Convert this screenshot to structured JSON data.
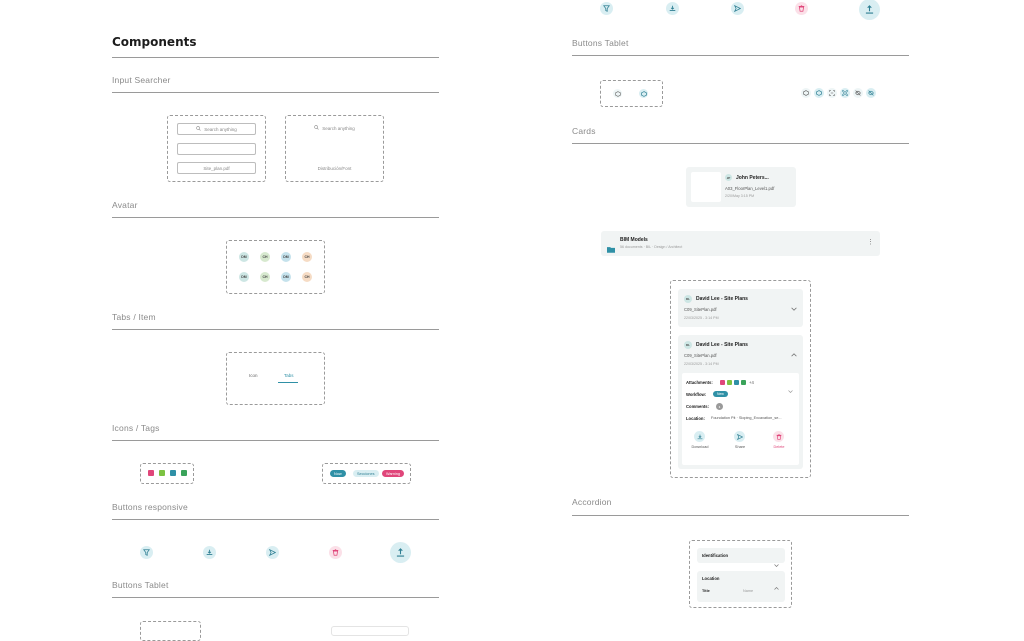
{
  "page": {
    "title": "Components"
  },
  "sections": {
    "input_searcher": "Input Searcher",
    "avatar": "Avatar",
    "tabs_item": "Tabs / Item",
    "icons_tags": "Icons / Tags",
    "buttons_responsive": "Buttons responsive",
    "buttons_tablet": "Buttons Tablet",
    "cards": "Cards",
    "accordion": "Accordion"
  },
  "input_searcher": {
    "search_placeholder": "Search anything",
    "file_value": "Site_plan.pdf",
    "search_placeholder_2": "Search anything",
    "dropdown_text": "Distribución/Font"
  },
  "avatar": {
    "row1": [
      "DM",
      "CH",
      "DM",
      "CH"
    ],
    "row2": [
      "DM",
      "CH",
      "DM",
      "CH"
    ]
  },
  "tabs": {
    "tab1": "Icon",
    "tab2": "Tabs"
  },
  "tags": {
    "pill1": "Now",
    "pill2": "Secciones",
    "pill3": "Warning"
  },
  "cards": {
    "small": {
      "initials": "JP",
      "name": "John Peters...",
      "file": "A03_FloorPlan_Level1.pdf",
      "date": "2/20/May 3:15 PM"
    },
    "folder": {
      "name": "BIM Models",
      "meta": "56 documents  ·  BIL  ·  Design / Architect"
    },
    "big1": {
      "initials": "DL",
      "name": "David Lee - Site Plans",
      "file": "C09_SitePlan.pdf",
      "date": "22/03/2025 - 3:14 PM"
    },
    "big2": {
      "initials": "DL",
      "name": "David Lee - Site Plans",
      "file": "C09_SitePlan.pdf",
      "date": "22/03/2025 - 3:14 PM",
      "attachments_label": "Attachments:",
      "attachments_more": "+4",
      "workflow_label": "Workflow:",
      "workflow_value": "New",
      "comments_label": "Comments:",
      "comments_count": "1",
      "location_label": "Location:",
      "location_value": "Foundation Pit · Sloping_Excavation_se...",
      "download": "Download",
      "share": "Share",
      "delete": "Delete"
    }
  },
  "accordion": {
    "item1": "Identification",
    "item2": "Location",
    "row_label": "Title",
    "row_value": "Name"
  },
  "colors": {
    "accent": "#2f90a6",
    "icon_bg": "#d9eef2",
    "tag_pink": "#e0467a",
    "tag_green": "#7cc242",
    "tag_teal": "#2f90a6",
    "tag_dark_green": "#3aa35a",
    "pill_teal": "#2f90a6",
    "pill_red": "#e0467a"
  }
}
